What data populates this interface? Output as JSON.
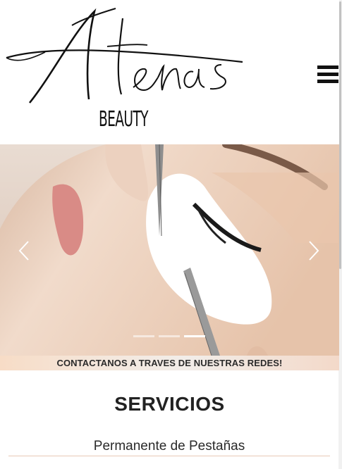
{
  "brand": {
    "script_name": "Atenas",
    "subtitle": "BEAUTY"
  },
  "header": {
    "menu_icon": "hamburger-icon"
  },
  "carousel": {
    "slides_count": 3,
    "active_slide": 3,
    "prev_icon": "chevron-left-icon",
    "next_icon": "chevron-right-icon"
  },
  "banner": {
    "text": "CONTACTANOS A TRAVES DE NUESTRAS REDES!"
  },
  "services": {
    "title": "SERVICIOS",
    "items": [
      {
        "label": "Permanente de Pestañas"
      }
    ]
  },
  "colors": {
    "banner_gradient_start": "#f7dcc6",
    "banner_gradient_end": "#f3d9c9",
    "item_underline": "#e8c9b5"
  }
}
